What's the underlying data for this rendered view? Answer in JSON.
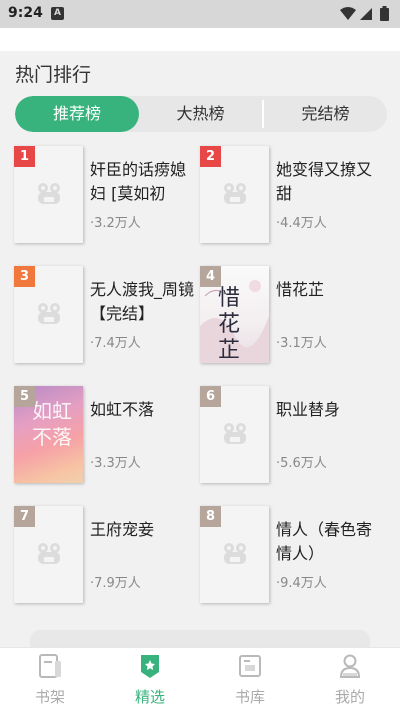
{
  "status_bar": {
    "time": "9:24",
    "notification_badge": "A",
    "icons": [
      "wifi-icon",
      "signal-icon",
      "battery-icon"
    ]
  },
  "section": {
    "title": "热门排行"
  },
  "tabs": [
    {
      "label": "推荐榜",
      "active": true
    },
    {
      "label": "大热榜",
      "active": false
    },
    {
      "label": "完结榜",
      "active": false
    }
  ],
  "books": [
    {
      "rank": "1",
      "title": "奸臣的话痨媳妇 [莫如初",
      "heat": "·3.2万人",
      "cover": "placeholder"
    },
    {
      "rank": "2",
      "title": "她变得又撩又甜",
      "heat": "·4.4万人",
      "cover": "placeholder"
    },
    {
      "rank": "3",
      "title": "无人渡我_周镜【完结】",
      "heat": "·7.4万人",
      "cover": "placeholder"
    },
    {
      "rank": "4",
      "title": "惜花芷",
      "heat": "·3.1万人",
      "cover": "art",
      "cover_text": "惜花芷"
    },
    {
      "rank": "5",
      "title": "如虹不落",
      "heat": "·3.3万人",
      "cover": "art",
      "cover_text": "如虹不落"
    },
    {
      "rank": "6",
      "title": "职业替身",
      "heat": "·5.6万人",
      "cover": "placeholder"
    },
    {
      "rank": "7",
      "title": "王府宠妾",
      "heat": "·7.9万人",
      "cover": "placeholder"
    },
    {
      "rank": "8",
      "title": "情人（春色寄情人）",
      "heat": "·9.4万人",
      "cover": "placeholder"
    }
  ],
  "bottom_nav": [
    {
      "label": "书架",
      "icon": "bookshelf-icon",
      "active": false
    },
    {
      "label": "精选",
      "icon": "featured-icon",
      "active": true
    },
    {
      "label": "书库",
      "icon": "library-icon",
      "active": false
    },
    {
      "label": "我的",
      "icon": "profile-icon",
      "active": false
    }
  ],
  "colors": {
    "accent": "#39b37e",
    "rank_top": "#e84747",
    "rank_third": "#f0783c",
    "rank_other": "#b5a59a"
  }
}
